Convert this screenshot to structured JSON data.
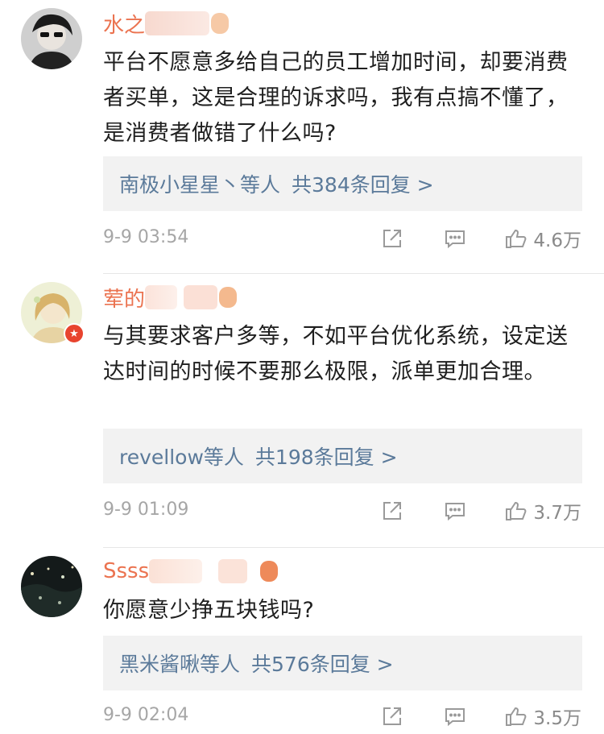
{
  "comments": [
    {
      "username": "水之",
      "text": "平台不愿意多给自己的员工增加时间，却要消费者买单，这是合理的诉求吗，我有点搞不懂了，是消费者做错了什么吗?",
      "replies_users": "南极小星星丶等人",
      "replies_count": "共384条回复 >",
      "time": "9-9 03:54",
      "likes": "4.6万"
    },
    {
      "username": "荤的",
      "text": "与其要求客户多等，不如平台优化系统，设定送达时间的时候不要那么极限，派单更加合理。",
      "replies_users": "revellow等人",
      "replies_count": "共198条回复 >",
      "time": "9-9 01:09",
      "likes": "3.7万"
    },
    {
      "username": "Ssss",
      "text": "你愿意少挣五块钱吗?",
      "replies_users": "黑米酱啾等人",
      "replies_count": "共576条回复 >",
      "time": "9-9 02:04",
      "likes": "3.5万"
    }
  ],
  "icons": {
    "share": "share-icon",
    "comment": "comment-icon",
    "like": "thumbs-up-icon",
    "badge": "star-badge-icon"
  },
  "colors": {
    "username": "#eb7350",
    "reply_link": "#5b7a9a",
    "meta": "#a6a6a6",
    "reply_bg": "#f2f2f2"
  }
}
